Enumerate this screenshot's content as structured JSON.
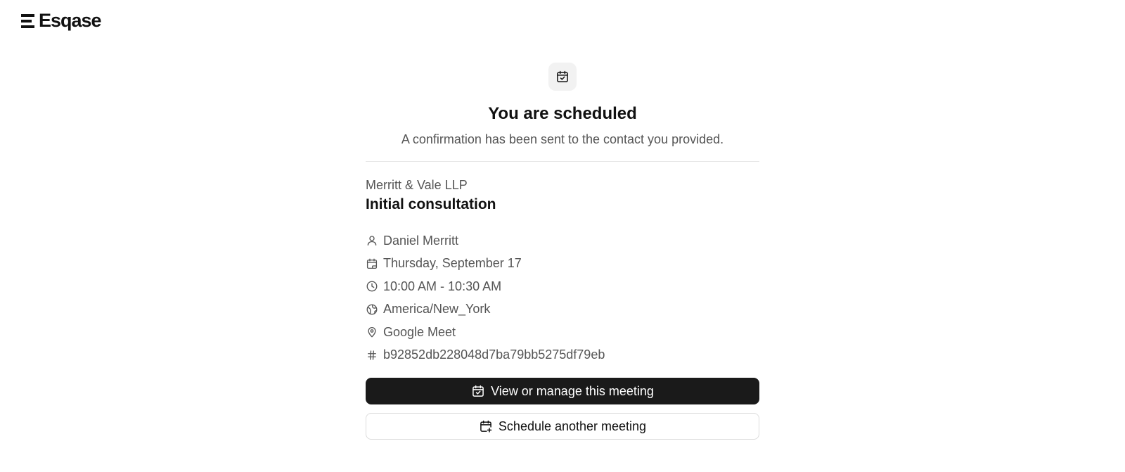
{
  "brand": {
    "name": "Esqase"
  },
  "header_icon": "calendar-check-icon",
  "confirmation": {
    "title": "You are scheduled",
    "subtitle": "A confirmation has been sent to the contact you provided."
  },
  "event": {
    "organization": "Merritt & Vale LLP",
    "name": "Initial consultation"
  },
  "details": {
    "host": {
      "icon": "user-icon",
      "text": "Daniel Merritt"
    },
    "date": {
      "icon": "calendar-icon",
      "text": "Thursday, September 17"
    },
    "time": {
      "icon": "clock-icon",
      "text": "10:00 AM - 10:30 AM"
    },
    "timezone": {
      "icon": "globe-icon",
      "text": "America/New_York"
    },
    "location": {
      "icon": "map-pin-icon",
      "text": "Google Meet"
    },
    "booking_id": {
      "icon": "hash-icon",
      "text": "b92852db228048d7ba79bb5275df79eb"
    }
  },
  "actions": {
    "manage_label": "View or manage this meeting",
    "schedule_label": "Schedule another meeting"
  },
  "colors": {
    "primary_button": "#1a1a1a",
    "text_muted": "#555555",
    "divider": "#e6e6e6"
  }
}
